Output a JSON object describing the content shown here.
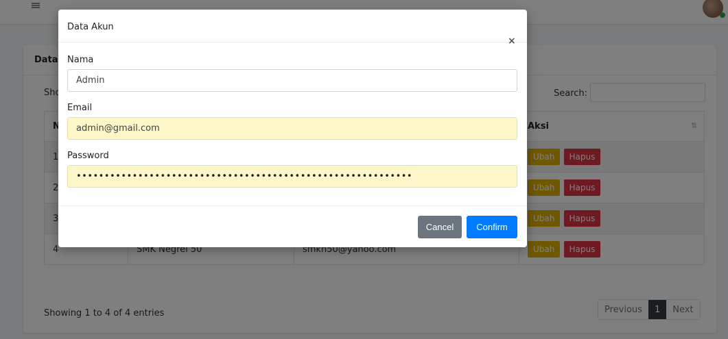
{
  "page": {
    "card_title": "Data",
    "show_label": "Sho",
    "search_label": "Search:",
    "table": {
      "headers": [
        "N",
        "",
        "",
        "Aksi"
      ],
      "rows": [
        {
          "no": "1",
          "name": "",
          "email": ""
        },
        {
          "no": "2",
          "name": "",
          "email": ""
        },
        {
          "no": "3",
          "name": "",
          "email": ""
        },
        {
          "no": "4",
          "name": "SMK Negrei 50",
          "email": "smkn50@yahoo.com"
        }
      ],
      "edit_label": "Ubah",
      "delete_label": "Hapus",
      "sort_icon": "⇅"
    },
    "info": "Showing 1 to 4 of 4 entries",
    "pagination": {
      "previous": "Previous",
      "current": "1",
      "next": "Next"
    }
  },
  "modal": {
    "title": "Data Akun",
    "close": "×",
    "fields": {
      "name_label": "Nama",
      "name_value": "Admin",
      "email_label": "Email",
      "email_value": "admin@gmail.com",
      "password_label": "Password",
      "password_value": "••••••••••••••••••••••••••••••••••••••••••••••••••••••••••••"
    },
    "cancel_label": "Cancel",
    "confirm_label": "Confirm"
  },
  "colors": {
    "confirm": "#007bff",
    "cancel": "#6c757d",
    "edit": "#e0b000",
    "delete": "#dc3545",
    "autofill": "#fdf6c8"
  }
}
